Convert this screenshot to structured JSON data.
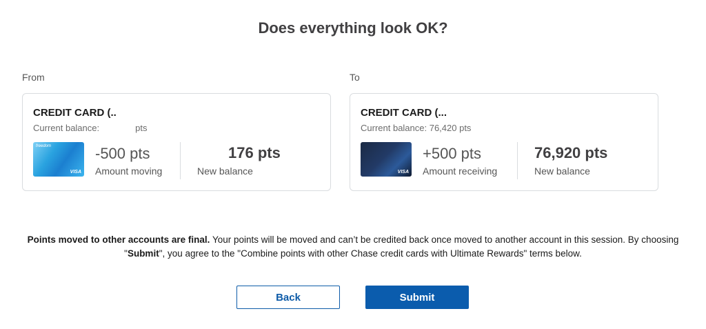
{
  "header": {
    "title": "Does everything look OK?"
  },
  "from": {
    "label": "From",
    "card_name": "CREDIT CARD (..",
    "balance_label": "Current balance:",
    "balance_suffix": "pts",
    "card_image": {
      "brand": "freedom",
      "network": "VISA"
    },
    "amount": "-500 pts",
    "amount_label": "Amount moving",
    "new_balance": "176 pts",
    "new_balance_label": "New balance"
  },
  "to": {
    "label": "To",
    "card_name": "CREDIT CARD (...",
    "balance_text": "Current balance: 76,420 pts",
    "card_image": {
      "brand": "sapphire",
      "network": "VISA"
    },
    "amount": "+500 pts",
    "amount_label": "Amount receiving",
    "new_balance": "76,920 pts",
    "new_balance_label": "New balance"
  },
  "notice": {
    "bold_lead": "Points moved to other accounts are final.",
    "text_1": " Your points will be moved and can’t be credited back once moved to another account in this session. By choosing \"",
    "bold_submit": "Submit",
    "text_2": "\", you agree to the \"Combine points with other Chase credit cards with Ultimate Rewards\" terms below."
  },
  "actions": {
    "back_label": "Back",
    "submit_label": "Submit"
  },
  "colors": {
    "primary": "#0b5cad",
    "border": "#d9dcdf",
    "text": "#414042"
  }
}
